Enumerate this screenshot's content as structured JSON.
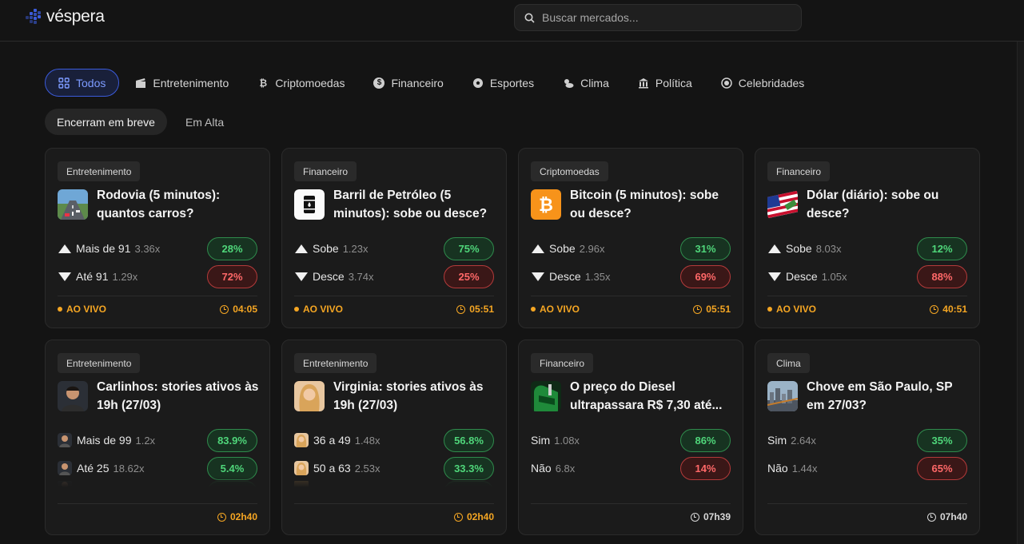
{
  "app": {
    "name": "véspera"
  },
  "search": {
    "placeholder": "Buscar mercados..."
  },
  "categories": [
    {
      "label": "Todos",
      "icon": "grid-icon",
      "active": true
    },
    {
      "label": "Entretenimento",
      "icon": "clapperboard-icon"
    },
    {
      "label": "Criptomoedas",
      "icon": "bitcoin-icon"
    },
    {
      "label": "Financeiro",
      "icon": "dollar-coin-icon"
    },
    {
      "label": "Esportes",
      "icon": "soccer-ball-icon"
    },
    {
      "label": "Clima",
      "icon": "weather-icon"
    },
    {
      "label": "Política",
      "icon": "capitol-icon"
    },
    {
      "label": "Celebridades",
      "icon": "star-icon"
    }
  ],
  "subtabs": [
    {
      "label": "Encerram em breve",
      "active": true
    },
    {
      "label": "Em Alta"
    }
  ],
  "live_label": "AO VIVO",
  "cards": [
    {
      "category": "Entretenimento",
      "title": "Rodovia (5 minutos): quantos carros?",
      "thumb": "highway-icon",
      "options": [
        {
          "label": "Mais de 91",
          "mult": "3.36x",
          "pct": "28%",
          "dir": "up"
        },
        {
          "label": "Até 91",
          "mult": "1.29x",
          "pct": "72%",
          "dir": "down"
        }
      ],
      "live": true,
      "timer": "04:05"
    },
    {
      "category": "Financeiro",
      "title": "Barril de Petróleo (5 minutos): sobe ou desce?",
      "thumb": "oil-barrel-icon",
      "options": [
        {
          "label": "Sobe",
          "mult": "1.23x",
          "pct": "75%",
          "dir": "up"
        },
        {
          "label": "Desce",
          "mult": "3.74x",
          "pct": "25%",
          "dir": "down"
        }
      ],
      "live": true,
      "timer": "05:51"
    },
    {
      "category": "Criptomoedas",
      "title": "Bitcoin (5 minutos): sobe ou desce?",
      "thumb": "bitcoin-icon",
      "options": [
        {
          "label": "Sobe",
          "mult": "2.96x",
          "pct": "31%",
          "dir": "up"
        },
        {
          "label": "Desce",
          "mult": "1.35x",
          "pct": "69%",
          "dir": "down"
        }
      ],
      "live": true,
      "timer": "05:51"
    },
    {
      "category": "Financeiro",
      "title": "Dólar (diário): sobe ou desce?",
      "thumb": "us-flag-icon",
      "options": [
        {
          "label": "Sobe",
          "mult": "8.03x",
          "pct": "12%",
          "dir": "up"
        },
        {
          "label": "Desce",
          "mult": "1.05x",
          "pct": "88%",
          "dir": "down"
        }
      ],
      "live": true,
      "timer": "40:51"
    },
    {
      "category": "Entretenimento",
      "title": "Carlinhos: stories ativos às 19h (27/03)",
      "thumb": "person-avatar",
      "options": [
        {
          "label": "Mais de 99",
          "mult": "1.2x",
          "pct": "83.9%",
          "dir": "yes"
        },
        {
          "label": "Até 25",
          "mult": "18.62x",
          "pct": "5.4%",
          "dir": "yes"
        }
      ],
      "live": false,
      "timer": "02h40"
    },
    {
      "category": "Entretenimento",
      "title": "Virginia: stories ativos às 19h (27/03)",
      "thumb": "person-avatar",
      "options": [
        {
          "label": "36 a 49",
          "mult": "1.48x",
          "pct": "56.8%",
          "dir": "yes"
        },
        {
          "label": "50 a 63",
          "mult": "2.53x",
          "pct": "33.3%",
          "dir": "yes"
        }
      ],
      "live": false,
      "timer": "02h40"
    },
    {
      "category": "Financeiro",
      "title": "O preço do Diesel ultrapassara R$ 7,30 até...",
      "thumb": "fuel-pump-icon",
      "options": [
        {
          "label": "Sim",
          "mult": "1.08x",
          "pct": "86%",
          "dir": "yes"
        },
        {
          "label": "Não",
          "mult": "6.8x",
          "pct": "14%",
          "dir": "no"
        }
      ],
      "live": false,
      "timer": "07h39"
    },
    {
      "category": "Clima",
      "title": "Chove em São Paulo, SP em 27/03?",
      "thumb": "city-photo",
      "options": [
        {
          "label": "Sim",
          "mult": "2.64x",
          "pct": "35%",
          "dir": "yes"
        },
        {
          "label": "Não",
          "mult": "1.44x",
          "pct": "65%",
          "dir": "no"
        }
      ],
      "live": false,
      "timer": "07h40"
    }
  ],
  "colors": {
    "accent": "#3b5bdb",
    "yes": "#4fd67a",
    "no": "#ff6868",
    "live": "#f5a623"
  }
}
